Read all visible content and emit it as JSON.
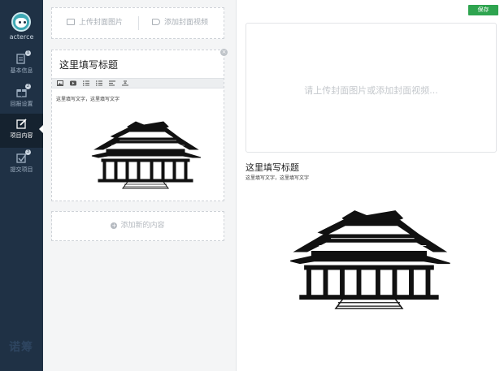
{
  "sidebar": {
    "username": "acterce",
    "items": [
      {
        "label": "基本信息",
        "badge": "1"
      },
      {
        "label": "回报设置",
        "badge": "2"
      },
      {
        "label": "项目内容",
        "badge": ""
      },
      {
        "label": "提交项目",
        "badge": "3"
      }
    ],
    "active_index": 2,
    "brand": "诺筹"
  },
  "editor": {
    "upload_image_label": "上传封面图片",
    "upload_video_label": "添加封面视频",
    "card": {
      "title": "这里填写标题",
      "close_symbol": "×",
      "toolbar": [
        "image-icon",
        "video-icon",
        "ordered-list-icon",
        "bullet-list-icon",
        "align-left-icon",
        "align-center-icon"
      ],
      "text": "这里填写文字，这里填写文字"
    },
    "add_content_label": "添加新的内容"
  },
  "preview": {
    "save_label": "保存",
    "cover_placeholder": "请上传封面图片或添加封面视频...",
    "title": "这里填写标题",
    "text": "这里填写文字，这里填写文字"
  },
  "colors": {
    "sidebar_bg": "#1f3145",
    "save_green": "#2ea44f"
  }
}
